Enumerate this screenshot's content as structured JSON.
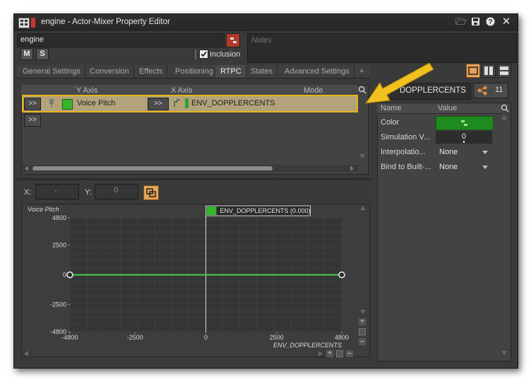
{
  "window": {
    "title": "engine - Actor-Mixer Property Editor"
  },
  "object": {
    "name_value": "engine",
    "notes_placeholder": "Notes",
    "mute_label": "M",
    "solo_label": "S",
    "inclusion_label": "Inclusion"
  },
  "tabs": [
    {
      "label": "General Settings"
    },
    {
      "label": "Conversion"
    },
    {
      "label": "Effects"
    },
    {
      "label": "Positioning"
    },
    {
      "label": "RTPC"
    },
    {
      "label": "States"
    },
    {
      "label": "Advanced Settings"
    },
    {
      "label": "+"
    }
  ],
  "rtpc_table": {
    "columns": [
      "Y Axis",
      "X Axis",
      "Mode"
    ],
    "row": {
      "expand_label": ">>",
      "y_axis": "Voice Pitch",
      "x_axis": "ENV_DOPPLERCENTS",
      "picker_label": ">>"
    },
    "new_row_label": ">>"
  },
  "coords": {
    "x_label": "X:",
    "x_value": "-",
    "y_label": "Y:",
    "y_value": "0"
  },
  "graph": {
    "y_title": "Voice Pitch",
    "x_title": "ENV_DOPPLERCENTS",
    "cursor_label": "ENV_DOPPLERCENTS (0.000)",
    "y_ticks": [
      "4800",
      "2500",
      "0",
      "-2500",
      "-4800"
    ],
    "x_ticks": [
      "-4800",
      "-2500",
      "0",
      "2500",
      "4800"
    ]
  },
  "chart_data": {
    "type": "line",
    "series": [
      {
        "name": "Voice Pitch",
        "x": [
          -4800,
          4800
        ],
        "y": [
          0,
          0
        ]
      }
    ],
    "xlabel": "ENV_DOPPLERCENTS",
    "ylabel": "Voice Pitch",
    "xlim": [
      -4800,
      4800
    ],
    "ylim": [
      -4800,
      4800
    ],
    "cursor_x": 0,
    "grid": true,
    "line_color": "#4bd04b"
  },
  "side_panel": {
    "rtpc_name": "DOPPLERCENTS",
    "count": "11",
    "headers": [
      "Name",
      "Value"
    ],
    "properties": [
      {
        "name": "Color",
        "value": ""
      },
      {
        "name": "Simulation V...",
        "value": "0"
      },
      {
        "name": "Interpolatio...",
        "value": "None"
      },
      {
        "name": "Bind to Built-...",
        "value": "None"
      }
    ]
  },
  "colors": {
    "accent_yellow": "#f2c11f",
    "highlight_row": "#b2a37a",
    "curve_green": "#4bd04b",
    "color_swatch": "#1f8a1f"
  }
}
